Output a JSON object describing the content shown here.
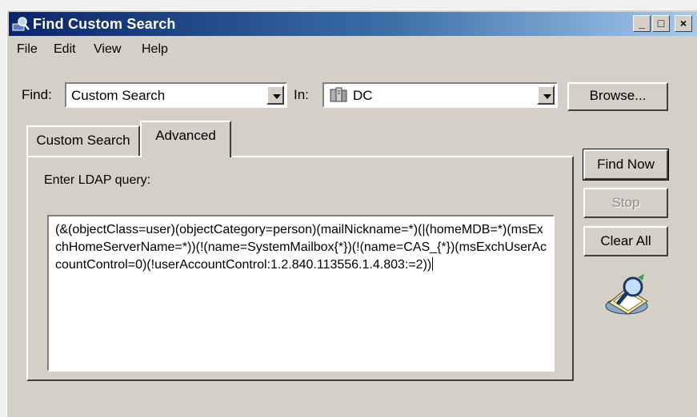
{
  "window": {
    "title": "Find Custom Search",
    "minimize_label": "_",
    "maximize_label": "□",
    "close_label": "×"
  },
  "menu": {
    "file": "File",
    "edit": "Edit",
    "view": "View",
    "help": "Help"
  },
  "find": {
    "label": "Find:",
    "value": "Custom Search"
  },
  "in": {
    "label": "In:",
    "value": "DC",
    "icon": "domain-controller-icon"
  },
  "buttons": {
    "browse": "Browse...",
    "find_now": "Find Now",
    "stop": "Stop",
    "clear_all": "Clear All"
  },
  "tabs": {
    "custom_search": "Custom Search",
    "advanced": "Advanced"
  },
  "advanced": {
    "prompt": "Enter LDAP query:",
    "query": "(&(objectClass=user)(objectCategory=person)(mailNickname=*)(|(homeMDB=*)(msExchHomeServerName=*))(!(name=SystemMailbox{*})(!(name=CAS_{*})(msExchUserAccountControl=0)(!userAccountControl:1.2.840.113556.1.4.803:=2))"
  },
  "colors": {
    "titlebar_start": "#0a246a",
    "titlebar_end": "#a6caf0",
    "face": "#d4d0c8"
  }
}
